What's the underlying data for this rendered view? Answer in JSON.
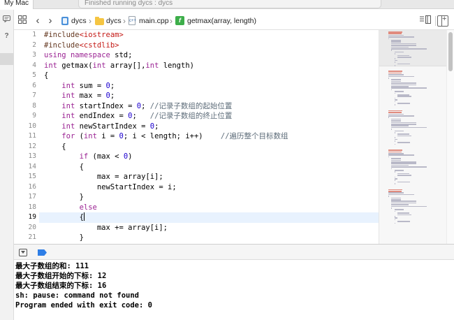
{
  "title_bar": {
    "scheme_label": "My Mac",
    "activity_status": "Finished running dycs : dycs"
  },
  "sidebar_strip": {
    "icons": [
      "comment-icon",
      "help-icon"
    ],
    "help_glyph": "?"
  },
  "jump_bar": {
    "crumbs": [
      {
        "label": "dycs",
        "icon": "project-icon"
      },
      {
        "label": "dycs",
        "icon": "folder-icon"
      },
      {
        "label": "main.cpp",
        "icon": "cpp-file-icon"
      },
      {
        "label": "getmax(array, length)",
        "icon": "function-icon"
      }
    ],
    "file_glyph": "c++",
    "function_glyph": "f"
  },
  "editor": {
    "current_line": 19,
    "lines": [
      {
        "n": "1",
        "text": "#include<iostream>"
      },
      {
        "n": "2",
        "text": "#include<cstdlib>"
      },
      {
        "n": "3",
        "text": "using namespace std;"
      },
      {
        "n": "4",
        "text": "int getmax(int array[],int length)"
      },
      {
        "n": "5",
        "text": "{"
      },
      {
        "n": "6",
        "text": "    int sum = 0;"
      },
      {
        "n": "7",
        "text": "    int max = 0;"
      },
      {
        "n": "8",
        "text": "    int startIndex = 0; //记录子数组的起始位置"
      },
      {
        "n": "9",
        "text": "    int endIndex = 0;   //记录子数组的终止位置"
      },
      {
        "n": "10",
        "text": "    int newStartIndex = 0;"
      },
      {
        "n": "11",
        "text": "    for (int i = 0; i < length; i++)    //遍历整个目标数组"
      },
      {
        "n": "12",
        "text": "    {"
      },
      {
        "n": "13",
        "text": "        if (max < 0)"
      },
      {
        "n": "14",
        "text": "        {"
      },
      {
        "n": "15",
        "text": "            max = array[i];"
      },
      {
        "n": "16",
        "text": "            newStartIndex = i;"
      },
      {
        "n": "17",
        "text": "        }"
      },
      {
        "n": "18",
        "text": "        else"
      },
      {
        "n": "19",
        "text": "        {"
      },
      {
        "n": "20",
        "text": "            max += array[i];"
      },
      {
        "n": "21",
        "text": "        }"
      }
    ]
  },
  "console": {
    "lines": [
      "最大子数组的和: 111",
      "最大子数组开始的下标: 12",
      "最大子数组结束的下标: 16",
      "sh: pause: command not found",
      "Program ended with exit code: 0"
    ]
  },
  "colors": {
    "keyword": "#9b2393",
    "preprocessor": "#643820",
    "string": "#c41a16",
    "number": "#1c00cf",
    "comment": "#5d6c79",
    "current_line_bg": "#e8f2fe",
    "breakpoint_accent": "#2e7ee6"
  }
}
